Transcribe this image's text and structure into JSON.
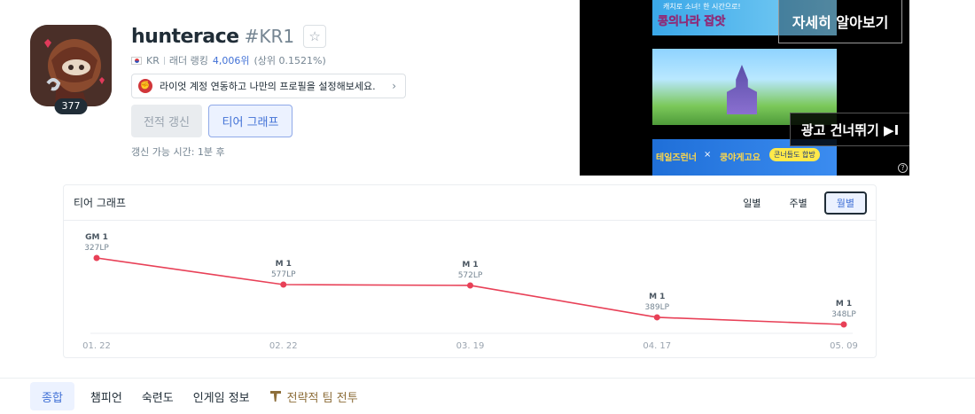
{
  "profile": {
    "name": "hunterace",
    "tag": "#KR1",
    "level": "377",
    "region": "KR",
    "ladder_label": "래더 랭킹",
    "ladder_rank": "4,006위",
    "ladder_percent": "(상위 0.1521%)",
    "riot_link_text": "라이엇 계정 연동하고 나만의 프로필을 설정해보세요.",
    "renew_button": "전적 갱신",
    "tier_graph_button": "티어 그래프",
    "renew_available": "갱신 가능 시간: 1분 후"
  },
  "ad": {
    "top_small_text": "캐치로 소녀! 한 시간으로!",
    "top_title": "콩의나라 잡앗",
    "learn_more": "자세히 알아보기",
    "skip": "광고 건너뛰기 ▶I",
    "bottom_brand": "테일즈런너",
    "bottom_x": "×",
    "bottom_collab": "쿵야게고요",
    "bottom_cta": "콘너들도 합방",
    "help_icon": "question-circle-icon"
  },
  "tier_graph": {
    "title": "티어 그래프",
    "periods": [
      "일별",
      "주별",
      "월별"
    ],
    "active_period": "월별"
  },
  "chart_data": {
    "type": "line",
    "x": [
      "01. 22",
      "02. 22",
      "03. 19",
      "04. 17",
      "05. 09"
    ],
    "series": [
      {
        "tier_labels": [
          "GM 1",
          "M 1",
          "M 1",
          "M 1",
          "M 1"
        ],
        "lp_labels": [
          "327LP",
          "577LP",
          "572LP",
          "389LP",
          "348LP"
        ],
        "values": [
          1327,
          577,
          572,
          389,
          348
        ]
      }
    ],
    "line_color": "#e84057",
    "grid": false
  },
  "nav": {
    "items": [
      "종합",
      "챔피언",
      "숙련도",
      "인게임 정보",
      "전략적 팀 전투"
    ],
    "active": "종합"
  }
}
